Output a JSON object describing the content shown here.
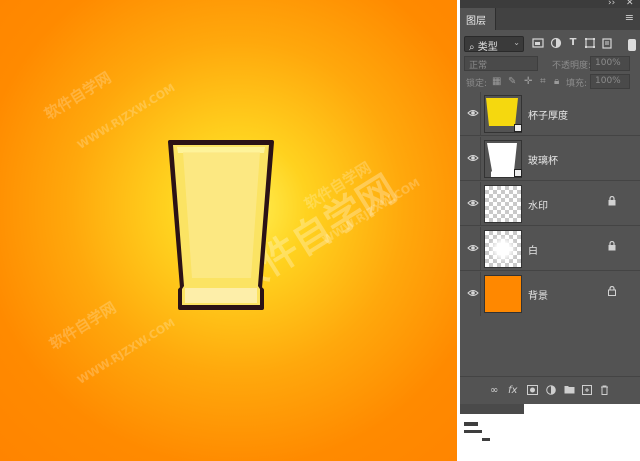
{
  "canvas": {
    "background_colors": [
      "#fff35a",
      "#ffd21f",
      "#ff8a00"
    ],
    "watermark_big": "软件自学网",
    "watermark_small_lines": [
      "软件自学网",
      "WWW.RJZXW.COM",
      "软件自学网",
      "WWW.RJZXW.COM",
      "软件自学网",
      "WWW.RJZXW.COM"
    ],
    "glass": {
      "fill": "#fbe363",
      "inner_fill": "#fde88a",
      "outline": "#2b1216"
    }
  },
  "panel": {
    "top_controls": [
      "››",
      "✕"
    ],
    "tab_label": "图层",
    "tab_menu_icon": "≡",
    "filter": {
      "selected": "类型",
      "search_icon": "⌕",
      "chevron": "⌄",
      "icons": [
        "image-filter-icon",
        "adjustment-filter-icon",
        "type-filter-icon",
        "shape-filter-icon",
        "smart-object-filter-icon"
      ]
    },
    "blend_mode": "正常",
    "opacity_label": "不透明度:",
    "opacity_value": "100%",
    "lock_label": "锁定:",
    "fill_label": "填充:",
    "fill_value": "100%",
    "layers": [
      {
        "name": "杯子厚度",
        "thumb": "#f5d80f",
        "locked": false,
        "linked": true
      },
      {
        "name": "玻璃杯",
        "thumb": "#ffffff",
        "locked": false,
        "linked": true
      },
      {
        "name": "水印",
        "thumb": "checker",
        "locked": true,
        "linked": false
      },
      {
        "name": "白",
        "thumb": "checker-glow",
        "locked": true,
        "linked": false
      },
      {
        "name": "背景",
        "thumb": "#ff8800",
        "locked": true,
        "linked": false
      }
    ],
    "footer_icons": [
      "link-icon",
      "fx-icon",
      "mask-icon",
      "adjustment-icon",
      "folder-icon",
      "new-layer-icon",
      "trash-icon"
    ]
  }
}
